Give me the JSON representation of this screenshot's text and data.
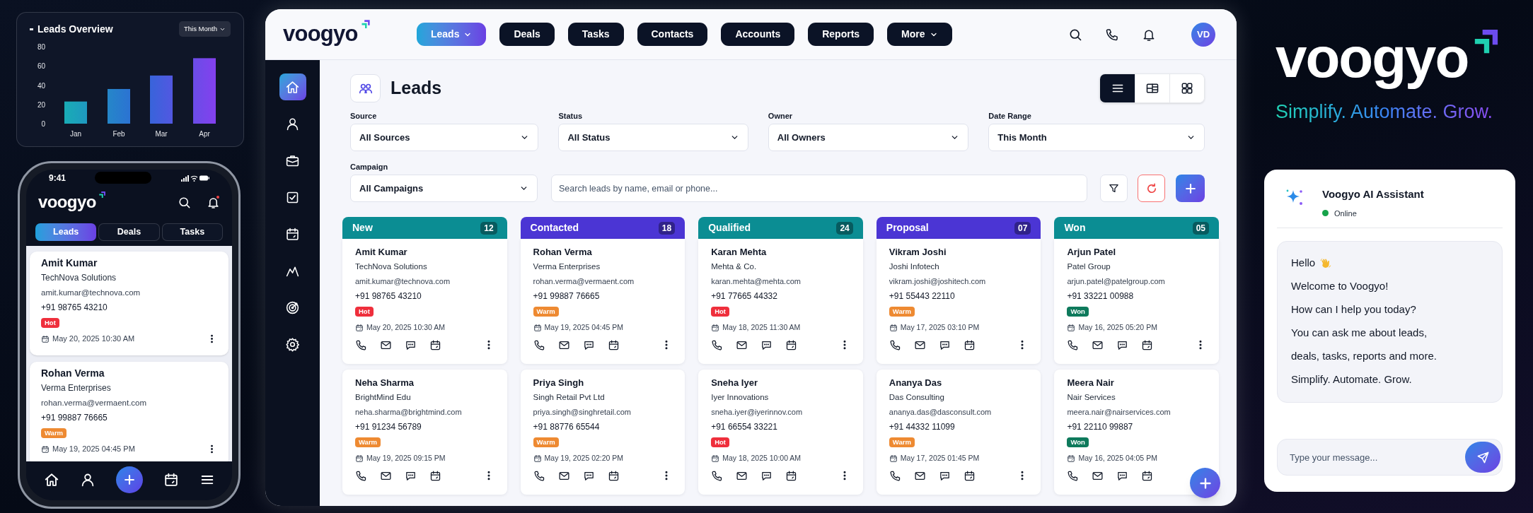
{
  "overview_widget": {
    "title": "Leads Overview",
    "period": "This Month",
    "chart_data": {
      "type": "bar",
      "categories": [
        "Jan",
        "Feb",
        "Mar",
        "Apr"
      ],
      "values": [
        23,
        36,
        50,
        68
      ],
      "ylim": [
        0,
        80
      ],
      "yticks": [
        0,
        20,
        40,
        60,
        80
      ]
    }
  },
  "phone": {
    "time": "9:41",
    "logo": "voogyo",
    "tabs": [
      {
        "label": "Leads",
        "selected": true
      },
      {
        "label": "Deals",
        "selected": false
      },
      {
        "label": "Tasks",
        "selected": false
      }
    ],
    "leads": [
      {
        "name": "Amit Kumar",
        "company": "TechNova Solutions",
        "email": "amit.kumar@technova.com",
        "phone": "+91 98765 43210",
        "tag": {
          "label": "Hot",
          "color": "#ef2f3c"
        },
        "date": "May 20, 2025 10:30 AM"
      },
      {
        "name": "Rohan Verma",
        "company": "Verma Enterprises",
        "email": "rohan.verma@vermaent.com",
        "phone": "+91 99887 76665",
        "tag": {
          "label": "Warm",
          "color": "#ee8a32"
        },
        "date": "May 19, 2025 04:45 PM"
      }
    ],
    "nav": [
      {
        "kind": "home"
      },
      {
        "kind": "user"
      },
      {
        "kind": "add"
      },
      {
        "kind": "calendar"
      },
      {
        "kind": "menu"
      }
    ]
  },
  "app": {
    "logo": "voogyo",
    "nav": [
      {
        "label": "Leads",
        "selected": true,
        "dropdown": true
      },
      {
        "label": "Deals",
        "selected": false,
        "dropdown": false
      },
      {
        "label": "Tasks",
        "selected": false,
        "dropdown": false
      },
      {
        "label": "Contacts",
        "selected": false,
        "dropdown": false
      },
      {
        "label": "Accounts",
        "selected": false,
        "dropdown": false
      },
      {
        "label": "Reports",
        "selected": false,
        "dropdown": false
      },
      {
        "label": "More",
        "selected": false,
        "dropdown": true
      }
    ],
    "avatar": "VD",
    "sidebar": [
      {
        "kind": "home",
        "selected": true
      },
      {
        "kind": "user",
        "selected": false
      },
      {
        "kind": "briefcase",
        "selected": false
      },
      {
        "kind": "tasks",
        "selected": false
      },
      {
        "kind": "calendar",
        "selected": false
      },
      {
        "kind": "chart",
        "selected": false
      },
      {
        "kind": "target",
        "selected": false
      },
      {
        "kind": "settings",
        "selected": false
      }
    ],
    "page_title": "Leads",
    "views": [
      {
        "kind": "list",
        "selected": true
      },
      {
        "kind": "board",
        "selected": false
      },
      {
        "kind": "grid",
        "selected": false
      }
    ],
    "filters": [
      {
        "label": "Source",
        "value": "All Sources"
      },
      {
        "label": "Status",
        "value": "All Status"
      },
      {
        "label": "Owner",
        "value": "All Owners"
      },
      {
        "label": "Date Range",
        "value": "This Month"
      },
      {
        "label": "Campaign",
        "value": "All Campaigns"
      }
    ],
    "search": {
      "placeholder": "Search leads by name, email or phone..."
    },
    "columns": [
      {
        "title": "New",
        "count": "12",
        "color": "#0b8d93",
        "cards": [
          {
            "name": "Amit Kumar",
            "company": "TechNova Solutions",
            "email": "amit.kumar@technova.com",
            "phone": "+91 98765 43210",
            "tag": {
              "label": "Hot",
              "color": "#ef2f3c"
            },
            "date": "May 20, 2025 10:30 AM"
          },
          {
            "name": "Neha Sharma",
            "company": "BrightMind Edu",
            "email": "neha.sharma@brightmind.com",
            "phone": "+91 91234 56789",
            "tag": {
              "label": "Warm",
              "color": "#ee8a32"
            },
            "date": "May 19, 2025 09:15 PM"
          }
        ]
      },
      {
        "title": "Contacted",
        "count": "18",
        "color": "#4b35d4",
        "cards": [
          {
            "name": "Rohan Verma",
            "company": "Verma Enterprises",
            "email": "rohan.verma@vermaent.com",
            "phone": "+91 99887 76665",
            "tag": {
              "label": "Warm",
              "color": "#ee8a32"
            },
            "date": "May 19, 2025 04:45 PM"
          },
          {
            "name": "Priya Singh",
            "company": "Singh Retail Pvt Ltd",
            "email": "priya.singh@singhretail.com",
            "phone": "+91 88776 65544",
            "tag": {
              "label": "Warm",
              "color": "#ee8a32"
            },
            "date": "May 19, 2025 02:20 PM"
          }
        ]
      },
      {
        "title": "Qualified",
        "count": "24",
        "color": "#0b8d93",
        "cards": [
          {
            "name": "Karan Mehta",
            "company": "Mehta & Co.",
            "email": "karan.mehta@mehta.com",
            "phone": "+91 77665 44332",
            "tag": {
              "label": "Hot",
              "color": "#ef2f3c"
            },
            "date": "May 18, 2025 11:30 AM"
          },
          {
            "name": "Sneha Iyer",
            "company": "Iyer Innovations",
            "email": "sneha.iyer@iyerinnov.com",
            "phone": "+91 66554 33221",
            "tag": {
              "label": "Hot",
              "color": "#ef2f3c"
            },
            "date": "May 18, 2025 10:00 AM"
          }
        ]
      },
      {
        "title": "Proposal",
        "count": "07",
        "color": "#4b35d4",
        "cards": [
          {
            "name": "Vikram Joshi",
            "company": "Joshi Infotech",
            "email": "vikram.joshi@joshitech.com",
            "phone": "+91 55443 22110",
            "tag": {
              "label": "Warm",
              "color": "#ee8a32"
            },
            "date": "May 17, 2025 03:10 PM"
          },
          {
            "name": "Ananya Das",
            "company": "Das Consulting",
            "email": "ananya.das@dasconsult.com",
            "phone": "+91 44332 11099",
            "tag": {
              "label": "Warm",
              "color": "#ee8a32"
            },
            "date": "May 17, 2025 01:45 PM"
          }
        ]
      },
      {
        "title": "Won",
        "count": "05",
        "color": "#0b8d93",
        "cards": [
          {
            "name": "Arjun Patel",
            "company": "Patel Group",
            "email": "arjun.patel@patelgroup.com",
            "phone": "+91 33221 00988",
            "tag": {
              "label": "Won",
              "color": "#0e7a5c"
            },
            "date": "May 16, 2025 05:20 PM"
          },
          {
            "name": "Meera Nair",
            "company": "Nair Services",
            "email": "meera.nair@nairservices.com",
            "phone": "+91 22110 99887",
            "tag": {
              "label": "Won",
              "color": "#0e7a5c"
            },
            "date": "May 16, 2025 04:05 PM"
          }
        ]
      }
    ]
  },
  "brand": {
    "logo": "voogyo",
    "tagline": "Simplify. Automate. Grow."
  },
  "assistant": {
    "title": "Voogyo AI Assistant",
    "status": "Online",
    "online": true,
    "messages": [
      {
        "text": "Hello",
        "kind": "greeting"
      },
      {
        "text": "Welcome to Voogyo!"
      },
      {
        "text": "How can I help you today?"
      },
      {
        "text": "You can ask me about leads,"
      },
      {
        "text": "deals, tasks, reports and more."
      },
      {
        "text": "Simplify. Automate. Grow."
      }
    ],
    "input": {
      "placeholder": "Type your message..."
    }
  }
}
